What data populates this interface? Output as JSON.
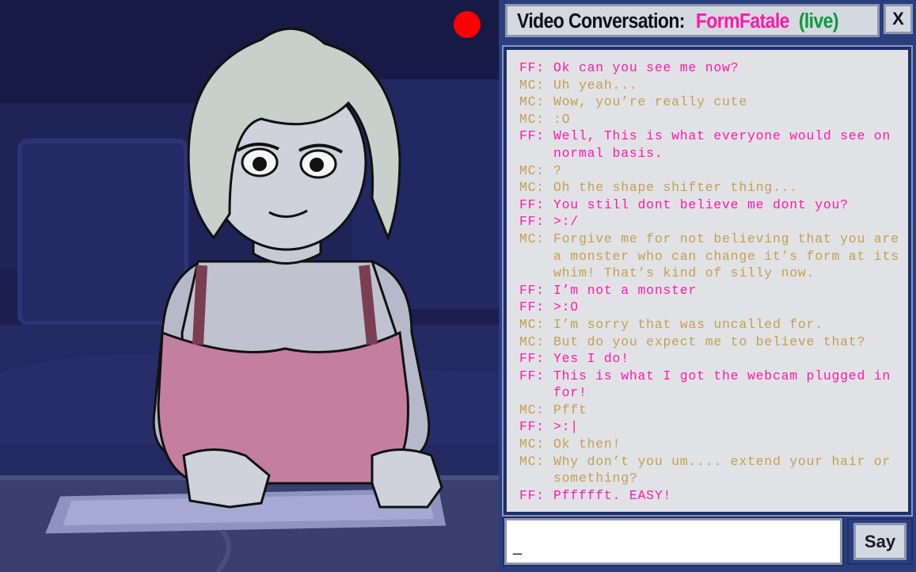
{
  "window": {
    "title_label": "Video Conversation:",
    "contact_name": "FormFatale",
    "status": "(live)",
    "close_label": "X"
  },
  "video": {
    "recording_indicator": "red-dot",
    "accent": "#ff0000"
  },
  "chat": {
    "messages": [
      {
        "who": "FF:",
        "text": "Ok can you see me now?"
      },
      {
        "who": "MC:",
        "text": "Uh yeah..."
      },
      {
        "who": "MC:",
        "text": "Wow, you’re really cute"
      },
      {
        "who": "MC:",
        "text": ":O"
      },
      {
        "who": "FF:",
        "text": "Well, This is what everyone would see on normal basis."
      },
      {
        "who": "MC:",
        "text": "?"
      },
      {
        "who": "MC:",
        "text": "Oh the shape shifter thing..."
      },
      {
        "who": "FF:",
        "text": "You still dont believe me dont you?"
      },
      {
        "who": "FF:",
        "text": ">:/"
      },
      {
        "who": "MC:",
        "text": "Forgive me for not believing that you are a monster who can change it’s form at its whim! That’s kind of silly now."
      },
      {
        "who": "FF:",
        "text": "I’m not a monster"
      },
      {
        "who": "FF:",
        "text": ">:O"
      },
      {
        "who": "MC:",
        "text": "I’m sorry that was uncalled for."
      },
      {
        "who": "MC:",
        "text": "But do you expect me to believe that?"
      },
      {
        "who": "FF:",
        "text": "Yes I do!"
      },
      {
        "who": "FF:",
        "text": "This is what I got the webcam plugged in for!"
      },
      {
        "who": "MC:",
        "text": "Pfft"
      },
      {
        "who": "FF:",
        "text": ">:|"
      },
      {
        "who": "MC:",
        "text": "Ok then!"
      },
      {
        "who": "MC:",
        "text": "Why don’t you um.... extend your hair or something?"
      },
      {
        "who": "FF:",
        "text": "Pffffft. EASY!"
      }
    ]
  },
  "input": {
    "value": "_"
  },
  "say_button": {
    "label": "Say"
  },
  "colors": {
    "ff_text": "#ff1aa8",
    "mc_text": "#c3a050",
    "live_status": "#0a9a3a",
    "panel_bg": "#2a3e7e"
  }
}
